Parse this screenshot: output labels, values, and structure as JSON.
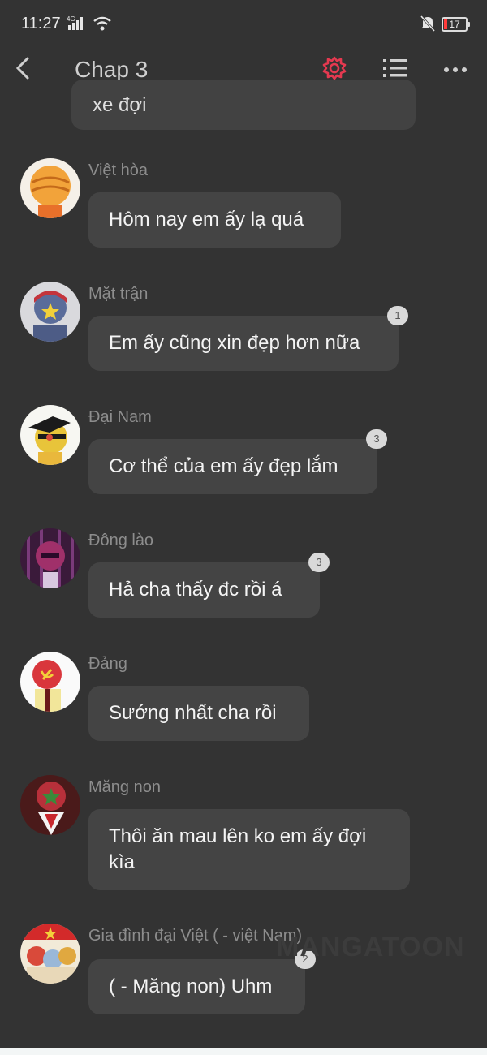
{
  "status_bar": {
    "time": "11:27",
    "network": "4G",
    "battery": "17"
  },
  "app_bar": {
    "title": "Chap 3",
    "accent": "#e53950"
  },
  "partial_message": {
    "text": "xe đợi"
  },
  "messages": [
    {
      "name": "Việt hòa",
      "text": "Hôm nay em ấy lạ quá",
      "badge": ""
    },
    {
      "name": "Mặt trận",
      "text": "Em ấy cũng xin đẹp hơn nữa",
      "badge": "1"
    },
    {
      "name": "Đại Nam",
      "text": "Cơ thể của em ấy đẹp lắm",
      "badge": "3"
    },
    {
      "name": "Đông lào",
      "text": "Hả cha thấy đc rồi á",
      "badge": "3"
    },
    {
      "name": "Đảng",
      "text": "Sướng nhất cha rồi",
      "badge": ""
    },
    {
      "name": "Măng non",
      "text": "Thôi ăn mau lên ko em ấy đợi kìa",
      "badge": ""
    },
    {
      "name": "Gia đình đại Việt ( - việt Nam)",
      "text": "( - Măng non) Uhm",
      "badge": "2"
    }
  ],
  "watermark": "MANGATOON"
}
